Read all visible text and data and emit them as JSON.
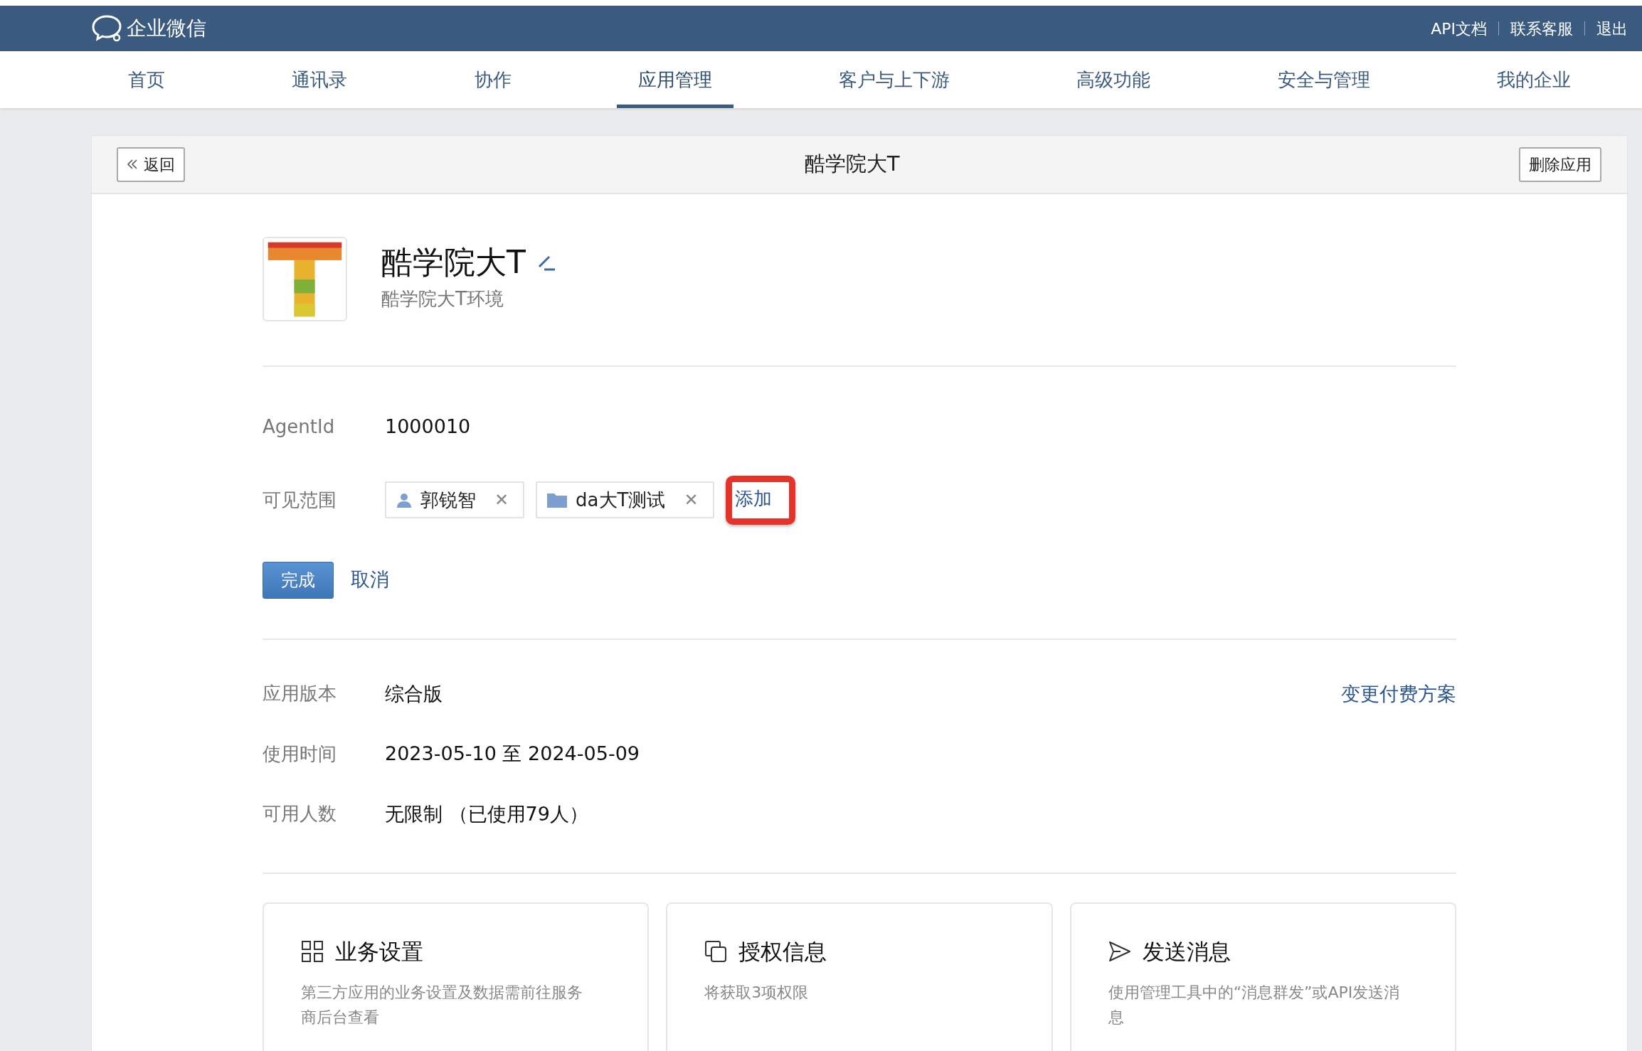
{
  "header": {
    "brand": "企业微信",
    "links": [
      "API文档",
      "联系客服",
      "退出"
    ]
  },
  "nav": [
    {
      "label": "首页",
      "selected": false
    },
    {
      "label": "通讯录",
      "selected": false
    },
    {
      "label": "协作",
      "selected": false
    },
    {
      "label": "应用管理",
      "selected": true
    },
    {
      "label": "客户与上下游",
      "selected": false
    },
    {
      "label": "高级功能",
      "selected": false
    },
    {
      "label": "安全与管理",
      "selected": false
    },
    {
      "label": "我的企业",
      "selected": false
    }
  ],
  "panel": {
    "back_label": "返回",
    "title": "酷学院大T",
    "delete_label": "删除应用"
  },
  "app": {
    "name": "酷学院大T",
    "description": "酷学院大T环境"
  },
  "agent": {
    "label": "AgentId",
    "value": "1000010"
  },
  "visibility": {
    "label": "可见范围",
    "tags": [
      {
        "kind": "person",
        "label": "郭锐智",
        "remove": "✕"
      },
      {
        "kind": "department",
        "label": "da大T测试",
        "remove": "✕"
      }
    ],
    "add_link": {
      "label": "添加",
      "highlighted": true
    }
  },
  "actions": {
    "confirm": "完成",
    "cancel": "取消"
  },
  "details": [
    {
      "label": "应用版本",
      "value": "综合版",
      "link": "变更付费方案"
    },
    {
      "label": "使用时间",
      "value": "2023-05-10 至 2024-05-09"
    },
    {
      "label": "可用人数",
      "value": "无限制 （已使用79人）"
    }
  ],
  "cards": [
    {
      "kind": "grid",
      "title": "业务设置",
      "text": "第三方应用的业务设置及数据需前往服务商后台查看"
    },
    {
      "kind": "copy",
      "title": "授权信息",
      "text": "将获取3项权限"
    },
    {
      "kind": "send",
      "title": "发送消息",
      "text": "使用管理工具中的“消息群发”或API发送消息"
    }
  ]
}
